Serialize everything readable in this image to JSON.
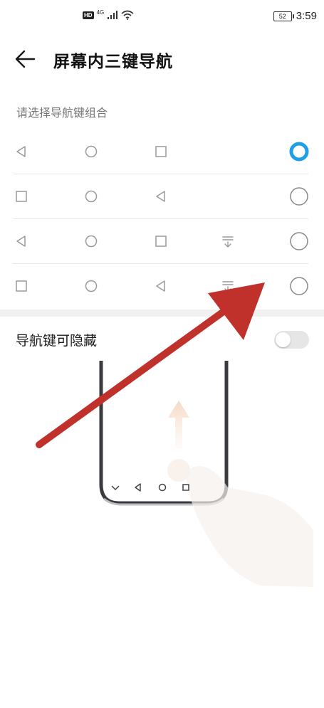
{
  "status_bar": {
    "hd_badge": "HD",
    "network_type": "4G",
    "battery_level": "52",
    "time": "3:59"
  },
  "header": {
    "title": "屏幕内三键导航",
    "back_icon": "arrow-left-icon"
  },
  "section": {
    "label": "请选择导航键组合"
  },
  "options": [
    {
      "icons": [
        "back-triangle-icon",
        "home-circle-icon",
        "recent-square-icon"
      ],
      "selected": true
    },
    {
      "icons": [
        "recent-square-icon",
        "home-circle-icon",
        "back-triangle-icon"
      ],
      "selected": false
    },
    {
      "icons": [
        "back-triangle-icon",
        "home-circle-icon",
        "recent-square-icon",
        "notification-pulldown-icon"
      ],
      "selected": false
    },
    {
      "icons": [
        "recent-square-icon",
        "home-circle-icon",
        "back-triangle-icon",
        "notification-pulldown-icon"
      ],
      "selected": false
    }
  ],
  "hide_nav": {
    "label": "导航键可隐藏",
    "enabled": false
  },
  "colors": {
    "accent": "#1e9fe6",
    "annotation_arrow": "#c0312b",
    "divider": "#e6e6e6",
    "icon_gray": "#9a9a9a"
  }
}
